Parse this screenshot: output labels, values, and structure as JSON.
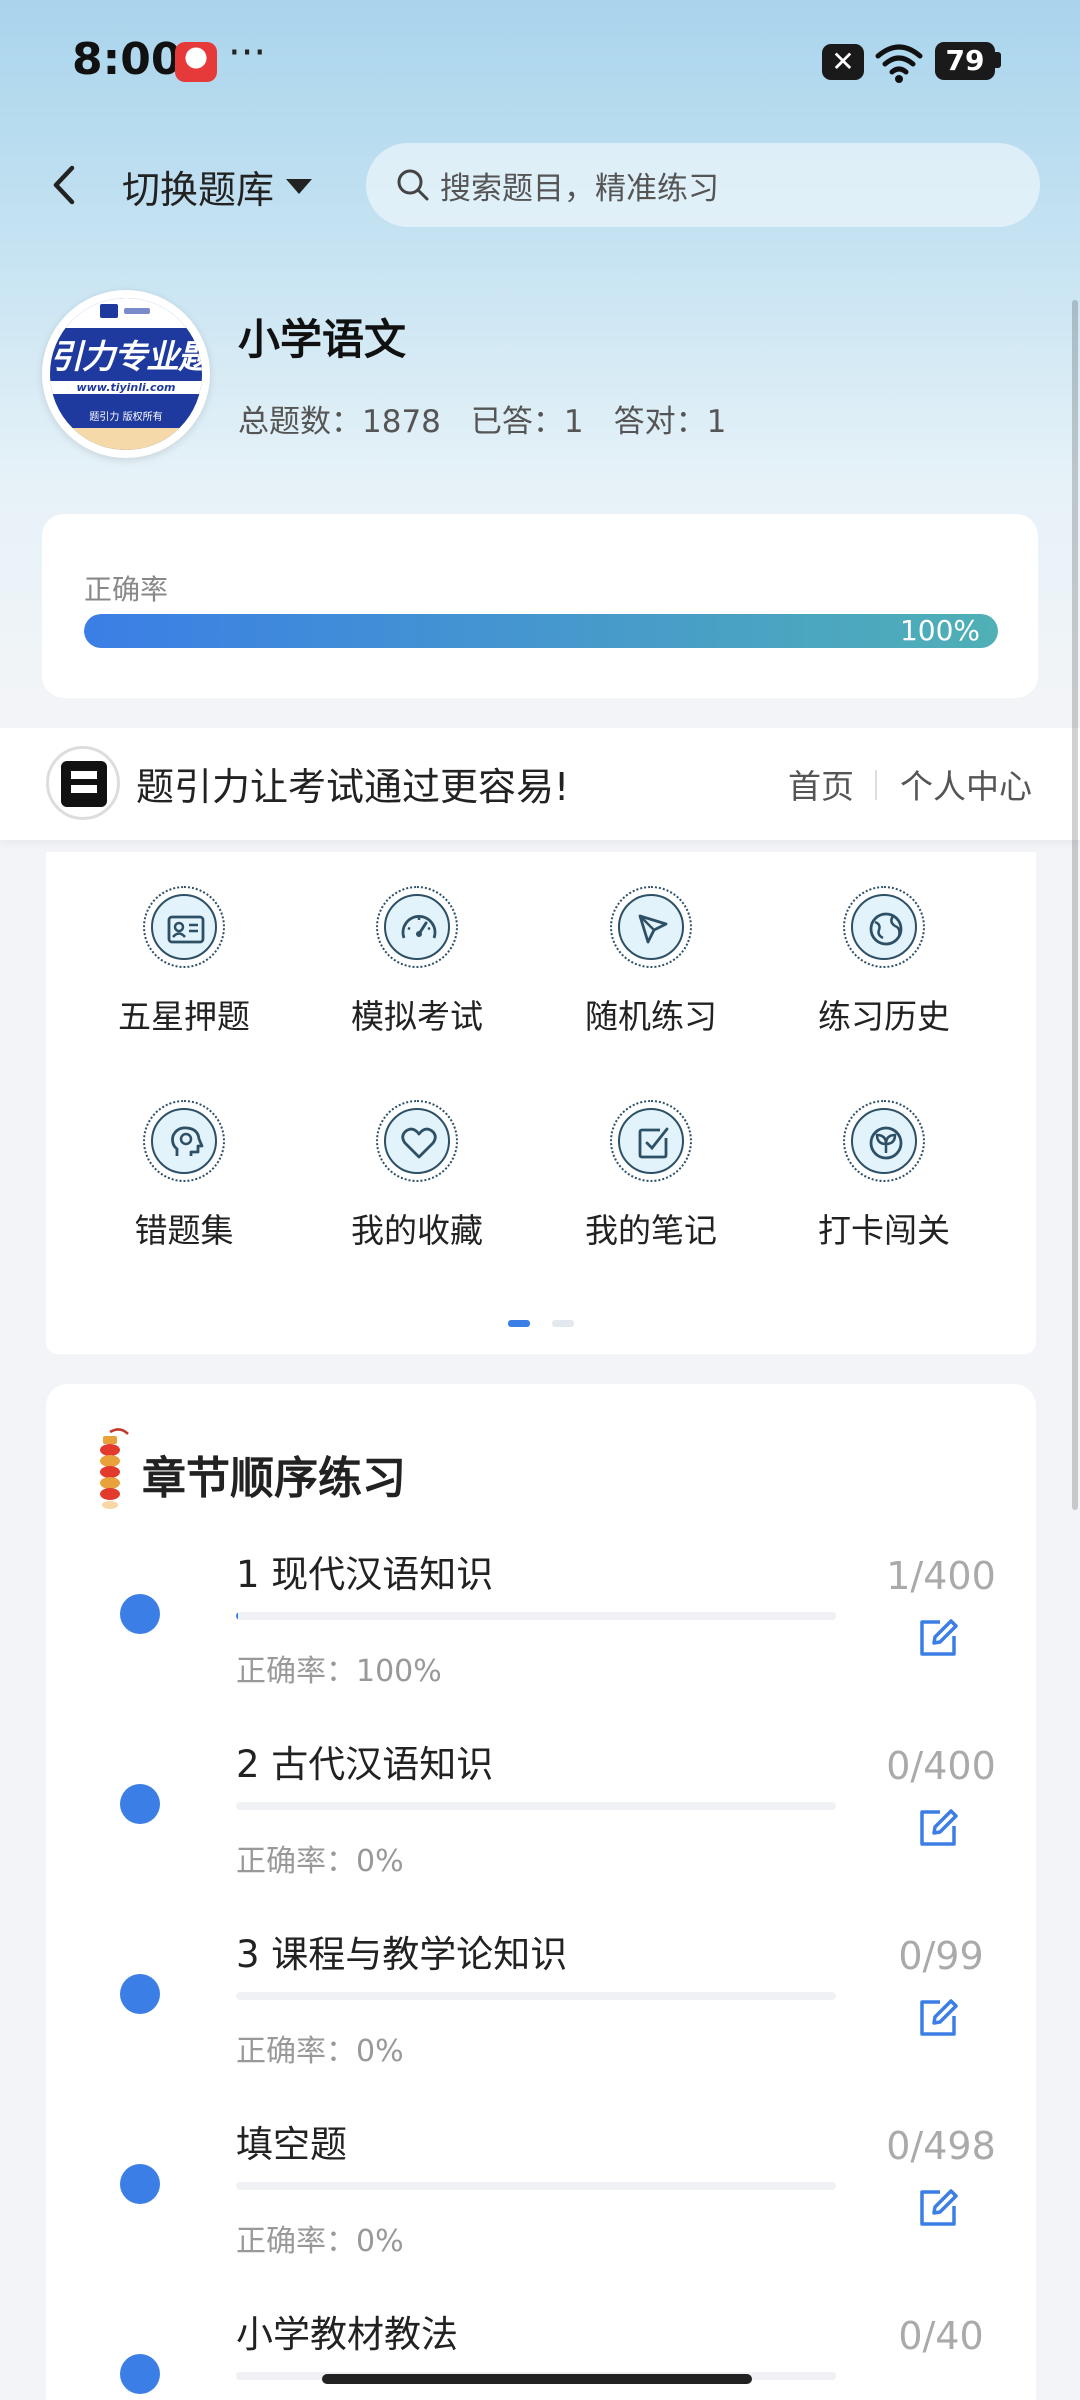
{
  "status_bar": {
    "time": "8:00",
    "more": "···",
    "battery": "79",
    "icons": [
      "app-notification-icon",
      "close-notification-icon",
      "wifi-icon",
      "battery-icon"
    ]
  },
  "header": {
    "switch_label": "切换题库",
    "search_placeholder": "搜索题目，精准练习"
  },
  "profile": {
    "logo_text": "引力专业题",
    "logo_url": "www.tiyinli.com",
    "logo_note": "题引力 版权所有",
    "subject": "小学语文",
    "total_label": "总题数：1878",
    "answered_label": "已答：1",
    "correct_label": "答对：1"
  },
  "accuracy": {
    "label": "正确率",
    "value_text": "100%",
    "value": 1.0
  },
  "banner": {
    "slogan": "题引力让考试通过更容易!",
    "home": "首页",
    "user_center": "个人中心"
  },
  "features": [
    {
      "label": "五星押题",
      "icon": "id-card-icon"
    },
    {
      "label": "模拟考试",
      "icon": "speedometer-icon"
    },
    {
      "label": "随机练习",
      "icon": "compass-icon"
    },
    {
      "label": "练习历史",
      "icon": "globe-icon"
    },
    {
      "label": "错题集",
      "icon": "brain-icon"
    },
    {
      "label": "我的收藏",
      "icon": "heart-icon"
    },
    {
      "label": "我的笔记",
      "icon": "note-check-icon"
    },
    {
      "label": "打卡闯关",
      "icon": "sprout-icon"
    }
  ],
  "chapters": {
    "title": "章节顺序练习",
    "items": [
      {
        "name": "1 现代汉语知识",
        "accuracy": "正确率：100%",
        "count": "1/400",
        "progress": 0.0025
      },
      {
        "name": "2 古代汉语知识",
        "accuracy": "正确率：0%",
        "count": "0/400",
        "progress": 0
      },
      {
        "name": "3 课程与教学论知识",
        "accuracy": "正确率：0%",
        "count": "0/99",
        "progress": 0
      },
      {
        "name": "填空题",
        "accuracy": "正确率：0%",
        "count": "0/498",
        "progress": 0
      },
      {
        "name": "小学教材教法",
        "accuracy": "",
        "count": "0/40",
        "progress": 0
      }
    ]
  },
  "colors": {
    "accent": "#3b7ee6",
    "accent_teal": "#4fb0b6",
    "icon_stroke": "#2d5066",
    "icon_bg": "#e3f3fb"
  }
}
